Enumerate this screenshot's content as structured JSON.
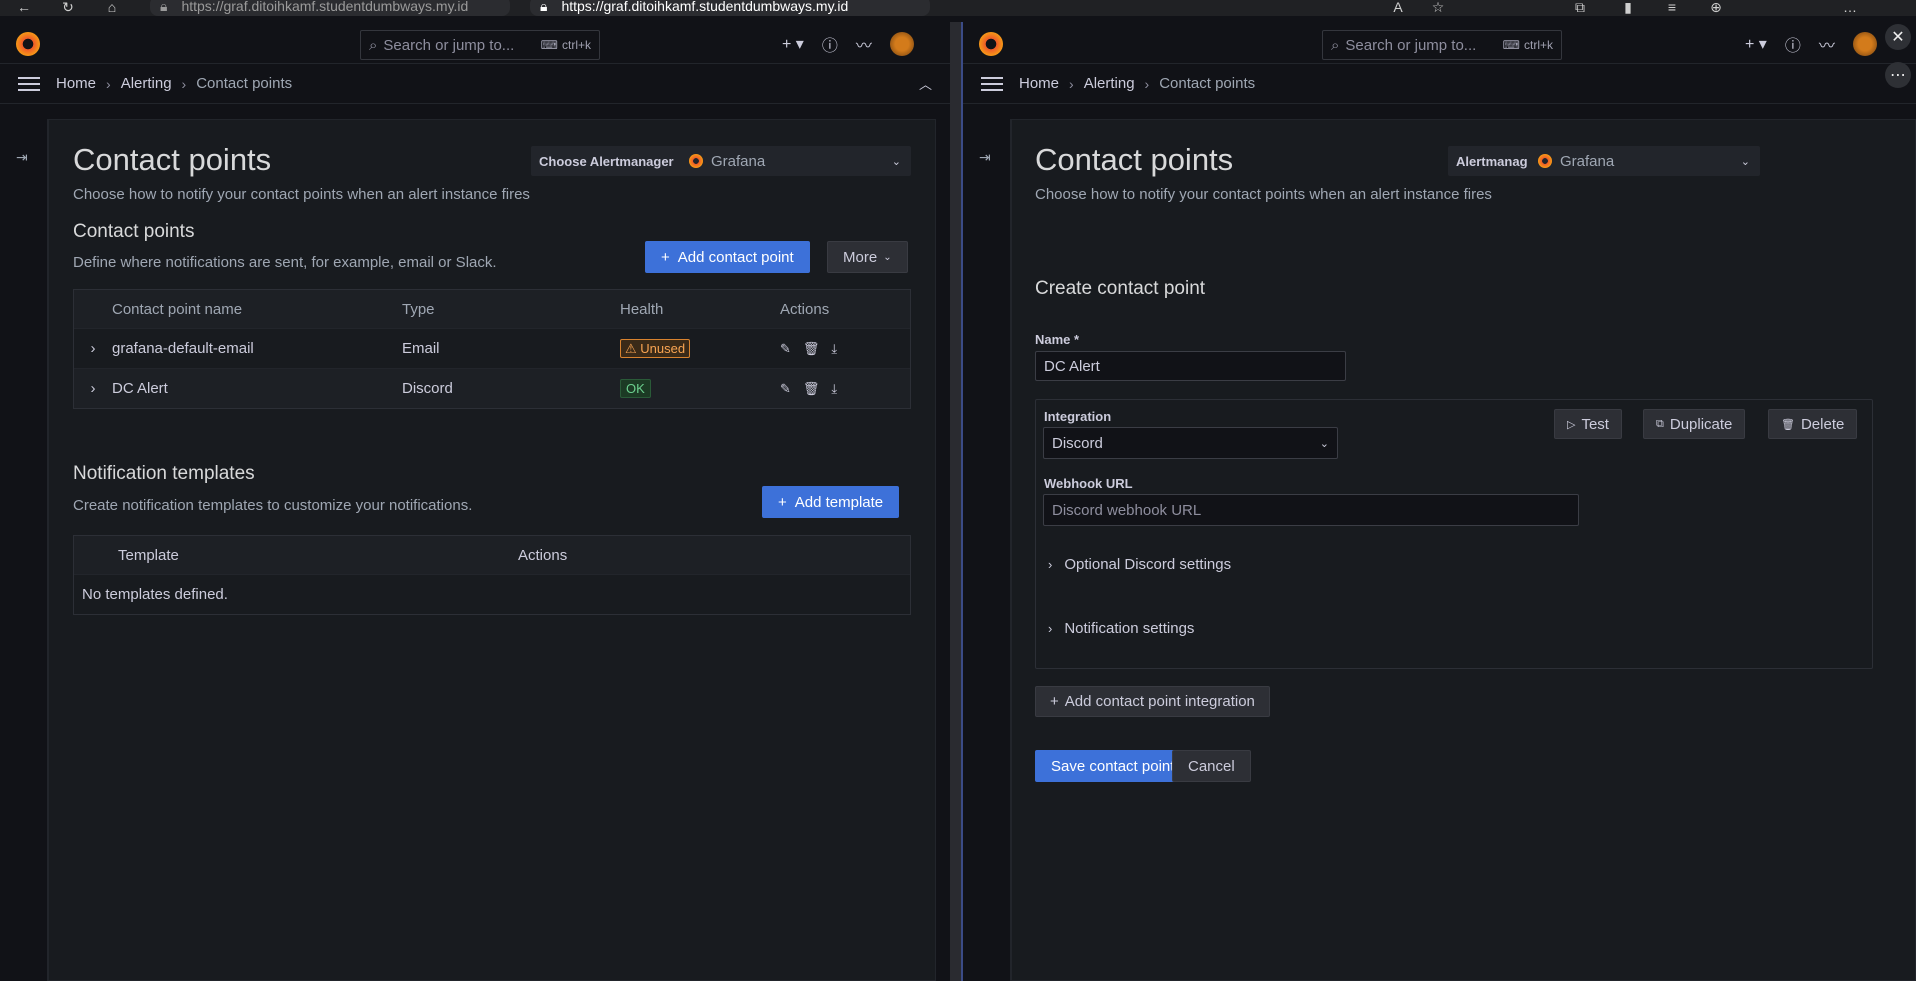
{
  "browser": {
    "url_left": "https://graf.ditoihkamf.studentdumbways.my.id",
    "url_right": "https://graf.ditoihkamf.studentdumbways.my.id",
    "icons": [
      "back-icon",
      "refresh-icon",
      "home-icon",
      "lock-icon",
      "read-aloud-icon",
      "favorite-icon",
      "extensions-icon",
      "split-screen-icon",
      "favorites-icon",
      "collections-icon",
      "more-icon"
    ]
  },
  "left": {
    "search": {
      "placeholder": "Search or jump to...",
      "shortcut": "ctrl+k"
    },
    "breadcrumb": [
      "Home",
      "Alerting",
      "Contact points"
    ],
    "title": "Contact points",
    "subtitle": "Choose how to notify your contact points when an alert instance fires",
    "am_label": "Choose Alertmanager",
    "am_value": "Grafana",
    "section_cp": {
      "title": "Contact points",
      "desc": "Define where notifications are sent, for example, email or Slack.",
      "add_label": "Add contact point",
      "more_label": "More"
    },
    "cp_table": {
      "headers": [
        "Contact point name",
        "Type",
        "Health",
        "Actions"
      ],
      "rows": [
        {
          "name": "grafana-default-email",
          "type": "Email",
          "health": "Unused"
        },
        {
          "name": "DC Alert",
          "type": "Discord",
          "health": "OK"
        }
      ]
    },
    "section_tpl": {
      "title": "Notification templates",
      "desc": "Create notification templates to customize your notifications.",
      "add_label": "Add template"
    },
    "tpl_table": {
      "headers": [
        "Template",
        "Actions"
      ],
      "empty": "No templates defined."
    }
  },
  "right": {
    "search": {
      "placeholder": "Search or jump to...",
      "shortcut": "ctrl+k"
    },
    "breadcrumb": [
      "Home",
      "Alerting",
      "Contact points"
    ],
    "title": "Contact points",
    "subtitle": "Choose how to notify your contact points when an alert instance fires",
    "am_label": "Alertmanager",
    "am_value": "Grafana",
    "form_title": "Create contact point",
    "name_label": "Name *",
    "name_value": "DC Alert",
    "integration_label": "Integration",
    "integration_value": "Discord",
    "test_label": "Test",
    "duplicate_label": "Duplicate",
    "delete_label": "Delete",
    "webhook_label": "Webhook URL",
    "webhook_placeholder": "Discord webhook URL",
    "optional_settings": "Optional Discord settings",
    "notification_settings": "Notification settings",
    "add_integration": "Add contact point integration",
    "save_label": "Save contact point",
    "cancel_label": "Cancel"
  },
  "colors": {
    "primary": "#3d71d9",
    "background": "#111217",
    "panel": "#181b1f",
    "warning": "#f8a452",
    "success": "#6ccf8e"
  }
}
